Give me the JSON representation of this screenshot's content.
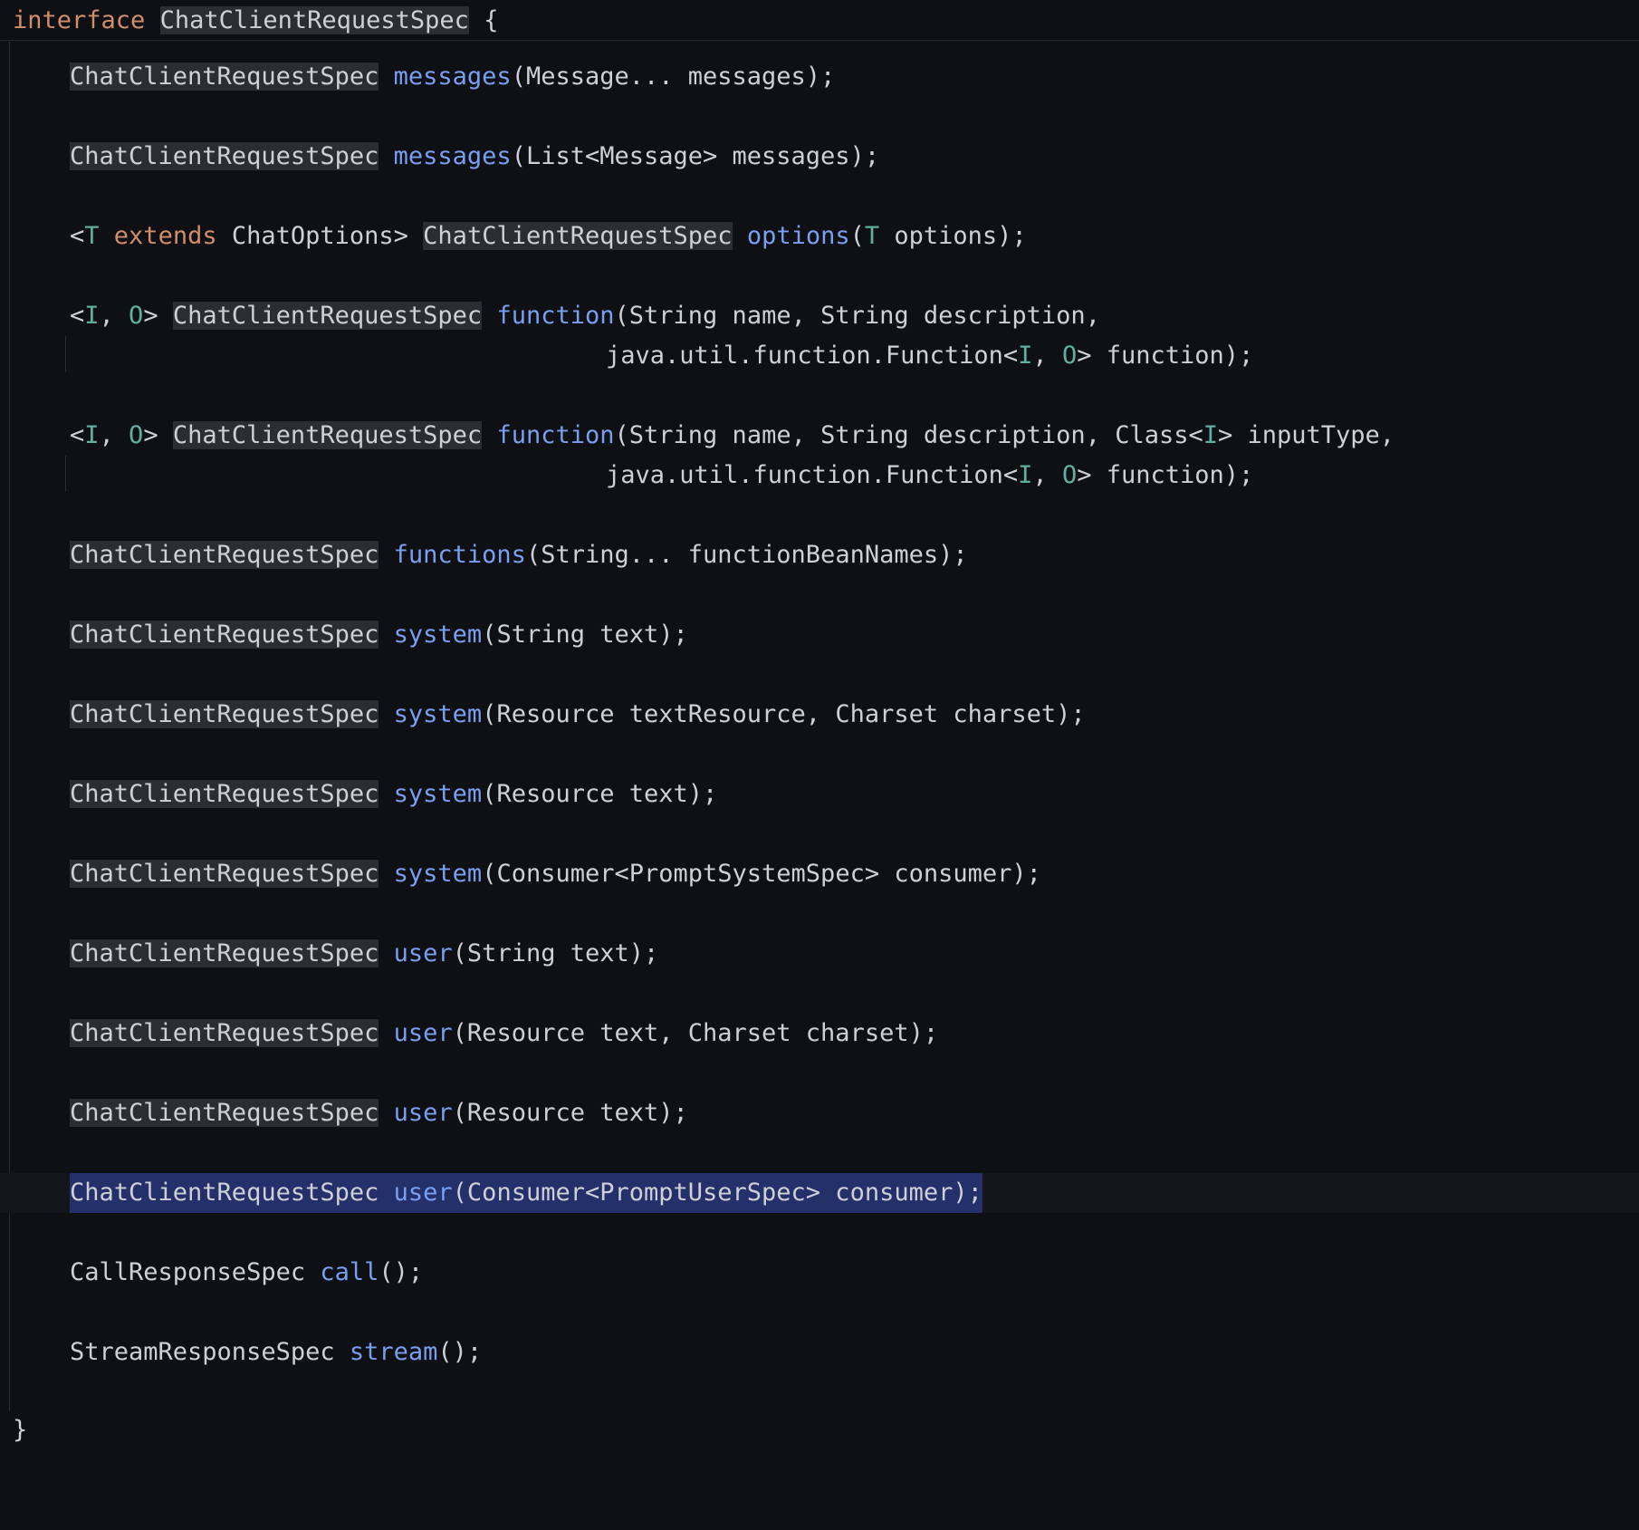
{
  "header": {
    "keyword": "interface",
    "name": "ChatClientRequestSpec",
    "open": " {"
  },
  "methods": [
    {
      "ret": "ChatClientRequestSpec",
      "name": "messages",
      "args": "(Message... messages);"
    },
    {
      "ret": "ChatClientRequestSpec",
      "name": "messages",
      "args": "(List<Message> messages);"
    },
    {
      "gen_lt": "<",
      "gen_t": "T",
      "gen_ext": "extends",
      "gen_rest": " ChatOptions> ",
      "ret": "ChatClientRequestSpec",
      "name": "options",
      "args_open": "(",
      "args_t": "T",
      "args_rest": " options);"
    },
    {
      "gen_lt": "<",
      "gen_i": "I",
      "gen_c": ", ",
      "gen_o": "O",
      "gen_gt": "> ",
      "ret": "ChatClientRequestSpec",
      "name": "function",
      "args": "(String name, String description,",
      "cont_pre": "java.util.function.Function<",
      "cont_i": "I",
      "cont_c": ", ",
      "cont_o": "O",
      "cont_post": "> function);"
    },
    {
      "gen_lt": "<",
      "gen_i": "I",
      "gen_c": ", ",
      "gen_o": "O",
      "gen_gt": "> ",
      "ret": "ChatClientRequestSpec",
      "name": "function",
      "args_pre": "(String name, String description, Class<",
      "args_i": "I",
      "args_post": "> inputType,",
      "cont_pre": "java.util.function.Function<",
      "cont_i": "I",
      "cont_c": ", ",
      "cont_o": "O",
      "cont_post": "> function);"
    },
    {
      "ret": "ChatClientRequestSpec",
      "name": "functions",
      "args": "(String... functionBeanNames);"
    },
    {
      "ret": "ChatClientRequestSpec",
      "name": "system",
      "args": "(String text);"
    },
    {
      "ret": "ChatClientRequestSpec",
      "name": "system",
      "args": "(Resource textResource, Charset charset);"
    },
    {
      "ret": "ChatClientRequestSpec",
      "name": "system",
      "args": "(Resource text);"
    },
    {
      "ret": "ChatClientRequestSpec",
      "name": "system",
      "args": "(Consumer<PromptSystemSpec> consumer);"
    },
    {
      "ret": "ChatClientRequestSpec",
      "name": "user",
      "args": "(String text);"
    },
    {
      "ret": "ChatClientRequestSpec",
      "name": "user",
      "args": "(Resource text, Charset charset);"
    },
    {
      "ret": "ChatClientRequestSpec",
      "name": "user",
      "args": "(Resource text);"
    },
    {
      "ret": "ChatClientRequestSpec",
      "name": "user",
      "args": "(Consumer<PromptUserSpec> consumer);"
    },
    {
      "ret": "CallResponseSpec",
      "name": "call",
      "args": "();"
    },
    {
      "ret": "StreamResponseSpec",
      "name": "stream",
      "args": "();"
    }
  ],
  "footer": {
    "close": "}"
  }
}
